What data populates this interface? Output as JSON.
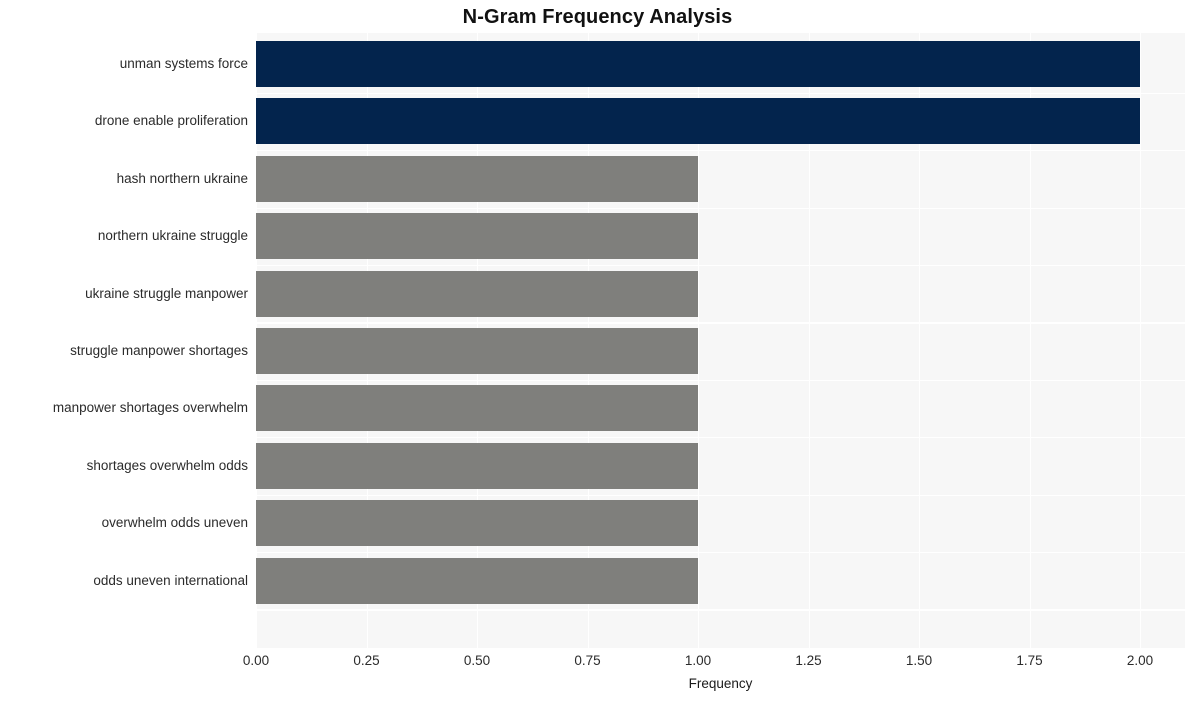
{
  "chart_data": {
    "type": "bar",
    "orientation": "horizontal",
    "title": "N-Gram Frequency Analysis",
    "xlabel": "Frequency",
    "ylabel": "",
    "categories": [
      "unman systems force",
      "drone enable proliferation",
      "hash northern ukraine",
      "northern ukraine struggle",
      "ukraine struggle manpower",
      "struggle manpower shortages",
      "manpower shortages overwhelm",
      "shortages overwhelm odds",
      "overwhelm odds uneven",
      "odds uneven international"
    ],
    "values": [
      2,
      2,
      1,
      1,
      1,
      1,
      1,
      1,
      1,
      1
    ],
    "bar_colors": [
      "#03244d",
      "#03244d",
      "#7f7f7c",
      "#7f7f7c",
      "#7f7f7c",
      "#7f7f7c",
      "#7f7f7c",
      "#7f7f7c",
      "#7f7f7c",
      "#7f7f7c"
    ],
    "xlim": [
      0.0,
      2.1
    ],
    "xticks": [
      "0.00",
      "0.25",
      "0.50",
      "0.75",
      "1.00",
      "1.25",
      "1.50",
      "1.75",
      "2.00"
    ],
    "xtick_values": [
      0.0,
      0.25,
      0.5,
      0.75,
      1.0,
      1.25,
      1.5,
      1.75,
      2.0
    ],
    "grid": true,
    "legend": "none",
    "plot_background": "#f7f7f7",
    "gridline_color": "#ffffff",
    "figure_background": "#ffffff",
    "highlight_color": "#03244d",
    "base_color": "#7f7f7c"
  }
}
